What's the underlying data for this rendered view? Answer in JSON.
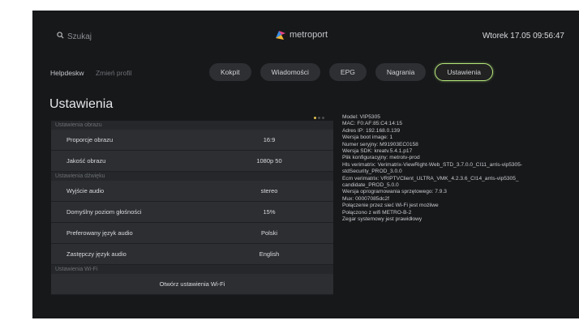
{
  "header": {
    "search_placeholder": "Szukaj",
    "logo_text": "metroport",
    "datetime": "Wtorek 17.05 09:56:47"
  },
  "profile": {
    "helpdesk": "Helpdeskw",
    "change_profile": "Zmień profil"
  },
  "tabs": [
    {
      "label": "Kokpit"
    },
    {
      "label": "Wiadomości"
    },
    {
      "label": "EPG"
    },
    {
      "label": "Nagrania"
    },
    {
      "label": "Ustawienia"
    }
  ],
  "page_title": "Ustawienia",
  "sections": {
    "image": {
      "label": "Ustawienia obrazu",
      "rows": [
        {
          "label": "Proporcje obrazu",
          "value": "16:9"
        },
        {
          "label": "Jakość obrazu",
          "value": "1080p 50"
        }
      ]
    },
    "sound": {
      "label": "Ustawienia dźwięku",
      "rows": [
        {
          "label": "Wyjście audio",
          "value": "stereo"
        },
        {
          "label": "Domyślny poziom głośności",
          "value": "15%"
        },
        {
          "label": "Preferowany język audio",
          "value": "Polski"
        },
        {
          "label": "Zastępczy język audio",
          "value": "English"
        }
      ]
    },
    "wifi": {
      "label": "Ustawienia Wi-Fi",
      "button": "Otwórz ustawienia Wi-Fi"
    }
  },
  "device_info": [
    "Model: VIP5305",
    "MAC: F0:AF:85:C4:14:15",
    "Adres IP: 192.168.0.139",
    "Wersja boot image: 1",
    "Numer seryjny: M91903EC0158",
    "Wersja SDK: kreatv.5.4.1.p17",
    "Plik konfiguracyjny: metrotv-prod",
    "Hls verimatrix: Verimatrix-ViewRight-Web_STD_3.7.0.0_CI11_arris-vip5305-",
    "stdSecurity_PROD_3.0.0",
    "Ecm verimatrix: VRIPTVClient_ULTRA_VMK_4.2.3.6_CI14_arris-vip5305_",
    "candidate_PROD_5.0.0",
    "Wersja oprogramowania sprzętowego: 7.9.3",
    "Mux: 00007085dc2f",
    "Połączenie przez sieć Wi-Fi jest możliwe",
    "Połączono z wifi METRO-B-2",
    "Zegar systemowy jest prawidłowy"
  ],
  "colors": {
    "background": "#17181a",
    "row": "#2c2e31",
    "accent": "#b4e67a",
    "indicator": "#e2c34a"
  }
}
